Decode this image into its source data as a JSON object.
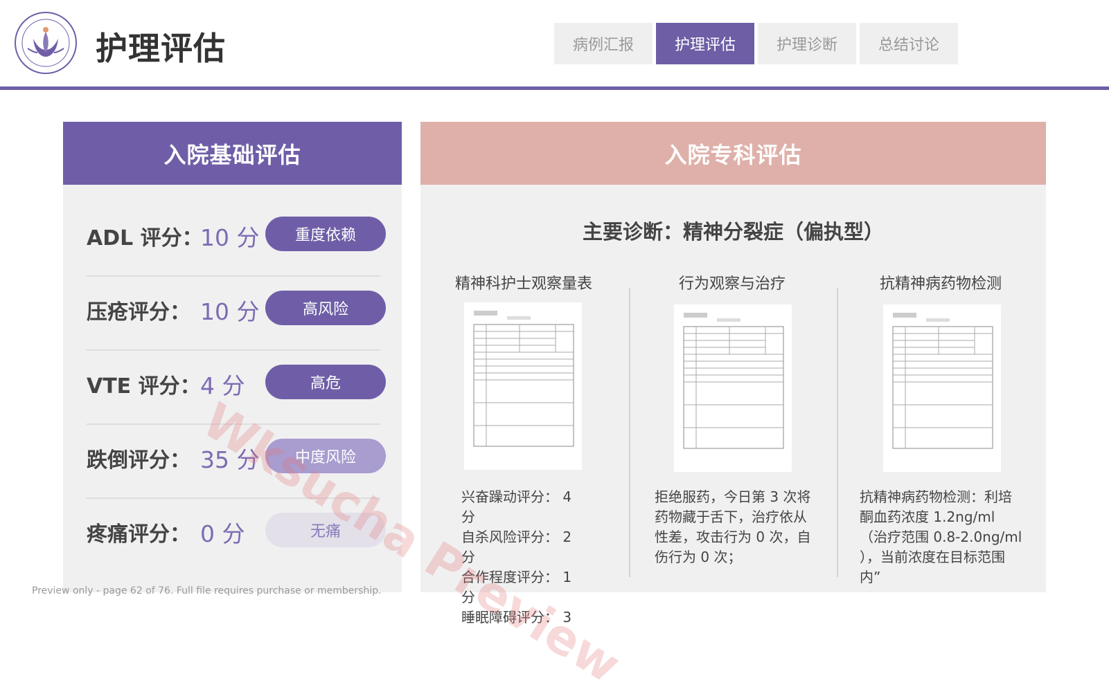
{
  "header": {
    "title": "护理评估",
    "tabs": [
      {
        "label": "病例汇报",
        "active": false
      },
      {
        "label": "护理评估",
        "active": true
      },
      {
        "label": "护理诊断",
        "active": false
      },
      {
        "label": "总结讨论",
        "active": false
      }
    ]
  },
  "basic": {
    "title": "入院基础评估",
    "items": [
      {
        "label": "ADL 评分：",
        "value": "10 分",
        "badge": "重度依赖",
        "badge_bg": "#6f5ea7",
        "badge_fg": "#ffffff"
      },
      {
        "label": "压疮评分：",
        "value": "10 分",
        "badge": "高风险",
        "badge_bg": "#6f5ea7",
        "badge_fg": "#ffffff"
      },
      {
        "label": "VTE 评分：",
        "value": "4 分",
        "badge": "高危",
        "badge_bg": "#6f5ea7",
        "badge_fg": "#ffffff"
      },
      {
        "label": "跌倒评分：",
        "value": "35 分",
        "badge": "中度风险",
        "badge_bg": "#a99ccf",
        "badge_fg": "#ffffff"
      },
      {
        "label": "疼痛评分：",
        "value": "0 分",
        "badge": "无痛",
        "badge_bg": "#e3e0ea",
        "badge_fg": "#8a7bb8"
      }
    ]
  },
  "special": {
    "title": "入院专科评估",
    "diagnosis": "主要诊断：精神分裂症（偏执型）",
    "columns": [
      {
        "title": "精神科护士观察量表",
        "lines": [
          "兴奋躁动评分： 4 分",
          "自杀风险评分： 2 分",
          "合作程度评分： 1 分",
          "睡眠障碍评分： 3"
        ]
      },
      {
        "title": "行为观察与治疗",
        "lines": [
          "拒绝服药，今日第 3 次将药物藏于舌下，治疗依从性差，攻击行为 0 次，自伤行为 0 次；"
        ]
      },
      {
        "title": "抗精神病药物检测",
        "lines": [
          "抗精神病药物检测：利培酮血药浓度 1.2ng/ml （治疗范围 0.8-2.0ng/ml ），当前浓度在目标范围内”"
        ]
      }
    ]
  },
  "watermark": "Wksucha Preview",
  "footer": "Preview only - page 62 of 76. Full file requires purchase or membership.",
  "colors": {
    "accent": "#6f5ea7",
    "accent_soft": "#deb0a9",
    "panel_bg": "#f0f0f1"
  }
}
